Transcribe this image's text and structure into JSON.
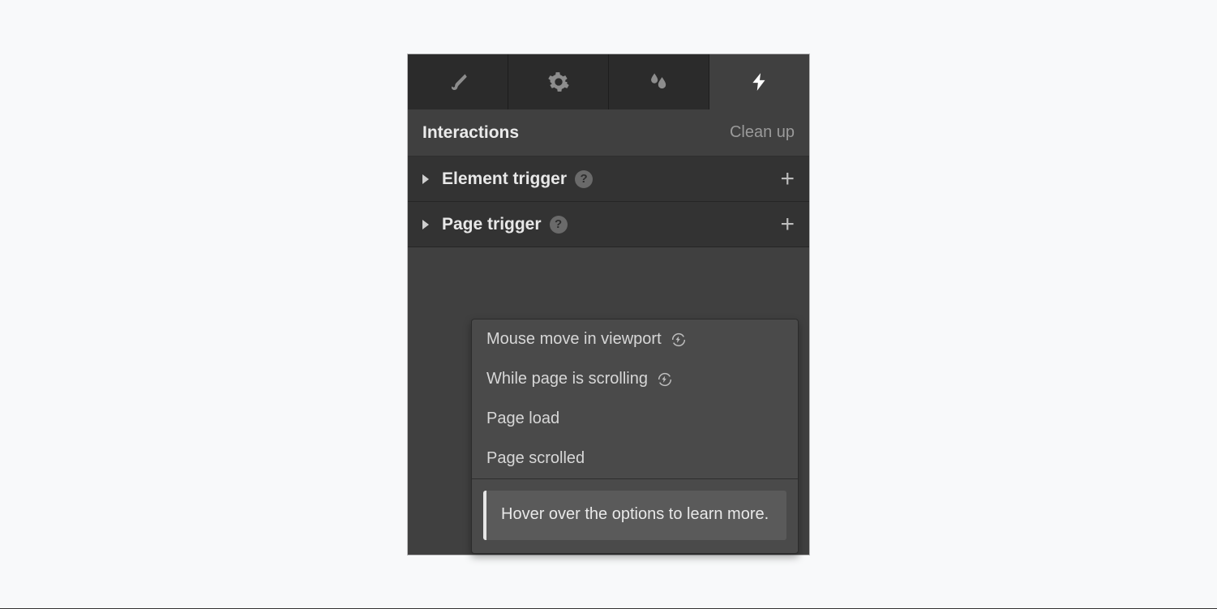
{
  "tabs": {
    "icons": [
      "brush",
      "gear",
      "effects",
      "interactions"
    ]
  },
  "panel": {
    "title": "Interactions",
    "cleanup_label": "Clean up"
  },
  "triggers": {
    "element": {
      "label": "Element trigger"
    },
    "page": {
      "label": "Page trigger"
    }
  },
  "page_trigger_menu": {
    "items": [
      {
        "label": "Mouse move in viewport",
        "continuous": true
      },
      {
        "label": "While page is scrolling",
        "continuous": true
      },
      {
        "label": "Page load",
        "continuous": false
      },
      {
        "label": "Page scrolled",
        "continuous": false
      }
    ],
    "hint": "Hover over the options to learn more."
  }
}
